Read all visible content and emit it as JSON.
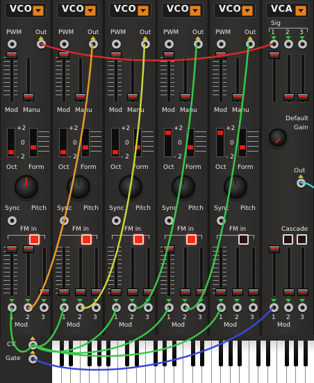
{
  "modules": [
    {
      "id": "vco1",
      "title": "VCO",
      "pwm_label": "PWM",
      "out_label": "Out",
      "mod_label": "Mod",
      "manu_label": "Manu",
      "oct_label": "Oct",
      "form_label": "Form",
      "sync_label": "Sync",
      "pitch_label": "Pitch",
      "fmin_label": "FM in",
      "mod_in_label": "Mod",
      "nums": [
        "1",
        "2",
        "3"
      ],
      "scale": [
        "+2",
        "0",
        "- 2"
      ],
      "fm_button_on": true
    },
    {
      "id": "vco2",
      "title": "VCO",
      "pwm_label": "PWM",
      "out_label": "Out",
      "mod_label": "Mod",
      "manu_label": "Manu",
      "oct_label": "Oct",
      "form_label": "Form",
      "sync_label": "Sync",
      "pitch_label": "Pitch",
      "fmin_label": "FM in",
      "mod_in_label": "Mod",
      "nums": [
        "1",
        "2",
        "3"
      ],
      "scale": [
        "+2",
        "0",
        "- 2"
      ],
      "fm_button_on": true
    },
    {
      "id": "vco3",
      "title": "VCO",
      "pwm_label": "PWM",
      "out_label": "Out",
      "mod_label": "Mod",
      "manu_label": "Manu",
      "oct_label": "Oct",
      "form_label": "Form",
      "sync_label": "Sync",
      "pitch_label": "Pitch",
      "fmin_label": "FM in",
      "mod_in_label": "Mod",
      "nums": [
        "1",
        "2",
        "3"
      ],
      "scale": [
        "+2",
        "0",
        "- 2"
      ],
      "fm_button_on": true
    },
    {
      "id": "vco4",
      "title": "VCO",
      "pwm_label": "PWM",
      "out_label": "Out",
      "mod_label": "Mod",
      "manu_label": "Manu",
      "oct_label": "Oct",
      "form_label": "Form",
      "sync_label": "Sync",
      "pitch_label": "Pitch",
      "fmin_label": "FM in",
      "mod_in_label": "Mod",
      "nums": [
        "1",
        "2",
        "3"
      ],
      "scale": [
        "+2",
        "0",
        "- 2"
      ],
      "fm_button_on": true
    },
    {
      "id": "vco5",
      "title": "VCO",
      "pwm_label": "PWM",
      "out_label": "Out",
      "mod_label": "Mod",
      "manu_label": "Manu",
      "oct_label": "Oct",
      "form_label": "Form",
      "sync_label": "Sync",
      "pitch_label": "Pitch",
      "fmin_label": "FM in",
      "mod_in_label": "Mod",
      "nums": [
        "1",
        "2",
        "3"
      ],
      "scale": [
        "+2",
        "0",
        "- 2"
      ],
      "fm_button_on": false
    }
  ],
  "vca": {
    "title": "VCA",
    "sig_label": "Sig",
    "nums": [
      "1",
      "2",
      "3"
    ],
    "default_label": "Default",
    "gain_label": "Gain",
    "out_label": "Out",
    "cascade_label": "Cascade",
    "mod_label": "Mod"
  },
  "keyboard": {
    "cv_label": "CV",
    "gate_label": "Gate"
  },
  "colors": {
    "accent": "#e8801a",
    "led_red": "#ff2a10",
    "cable_red": "#d82a2a",
    "cable_orange": "#e89a30",
    "cable_yellow": "#c8d83a",
    "cable_green": "#38c84a",
    "cable_teal": "#30c8a0",
    "cable_blue": "#3a48d8",
    "cable_cyan": "#40d0d8"
  }
}
